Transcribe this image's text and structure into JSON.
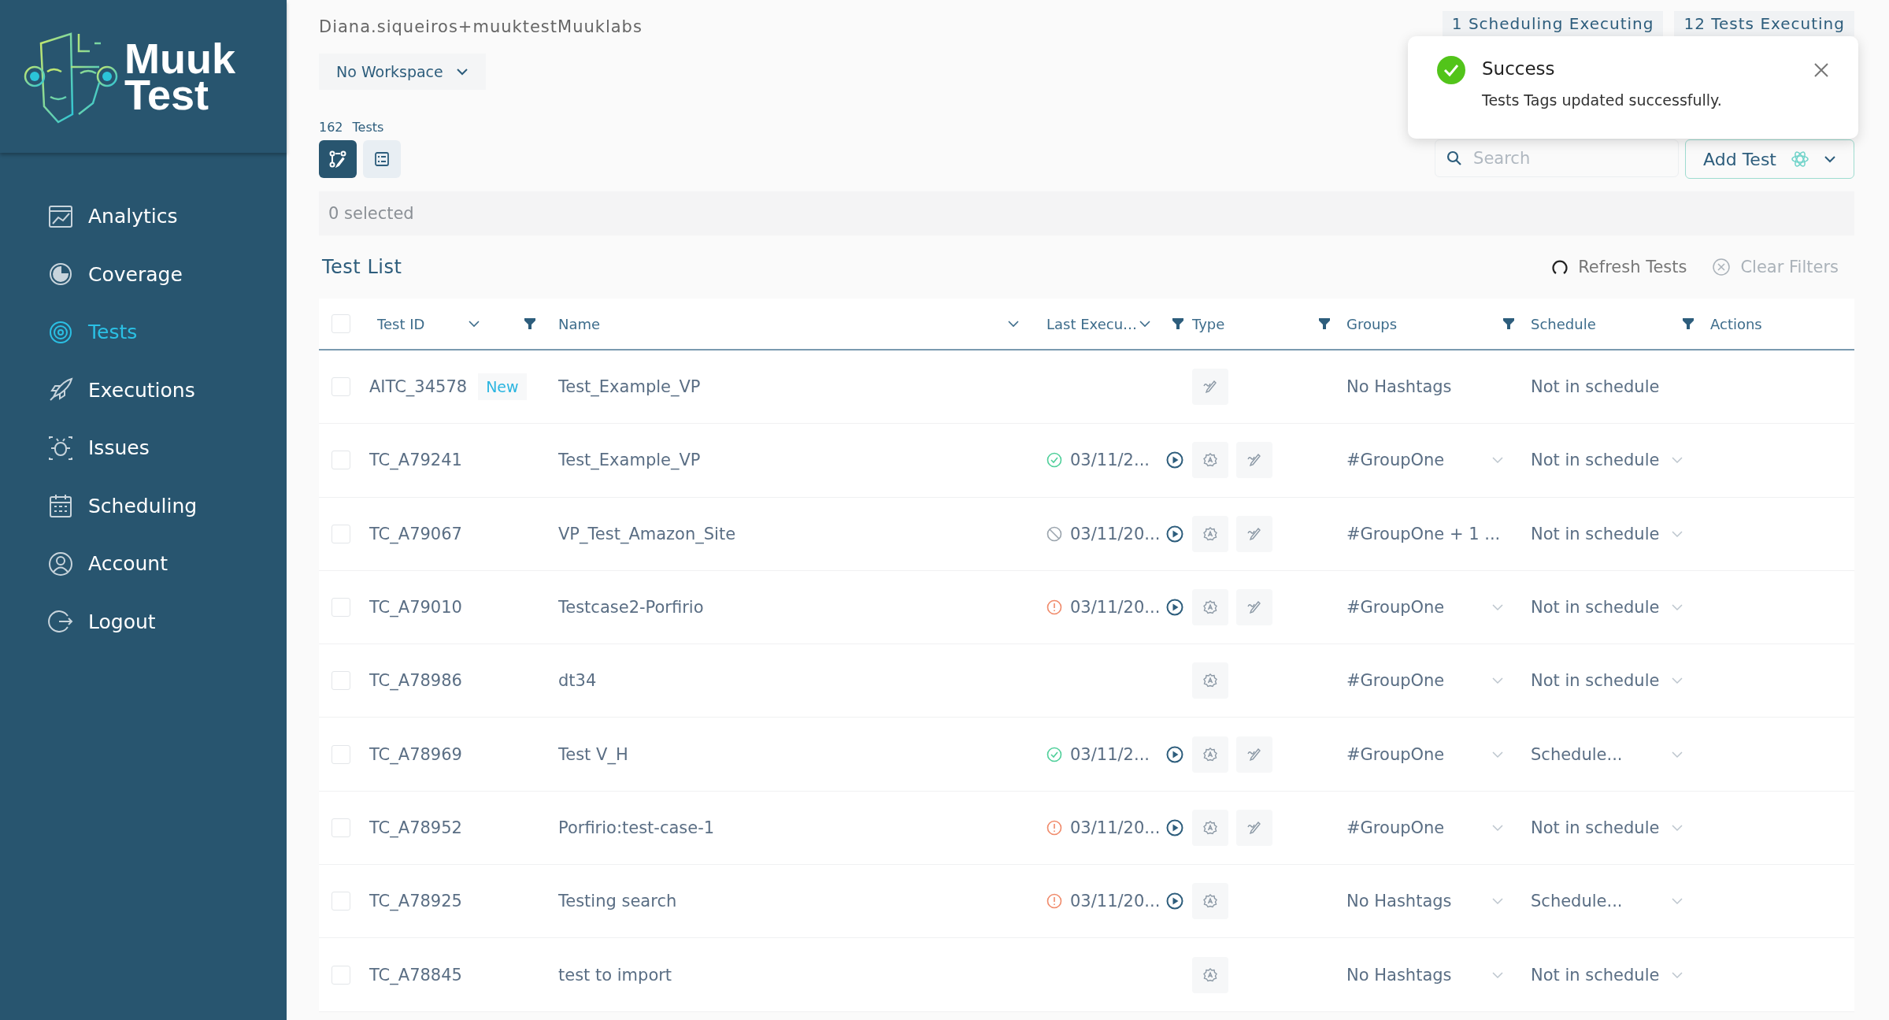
{
  "logo": {
    "line_1": "Muuk",
    "line_2": "Test"
  },
  "sidebar": {
    "items": [
      {
        "label": "Analytics",
        "selected": false
      },
      {
        "label": "Coverage",
        "selected": false
      },
      {
        "label": "Tests",
        "selected": true
      },
      {
        "label": "Executions",
        "selected": false
      },
      {
        "label": "Issues",
        "selected": false
      },
      {
        "label": "Scheduling",
        "selected": false
      },
      {
        "label": "Account",
        "selected": false
      },
      {
        "label": "Logout",
        "selected": false
      }
    ]
  },
  "header": {
    "user": "Diana.siqueiros+muuktestMuuklabs",
    "workspace": "No Workspace",
    "badges": [
      "1 Scheduling Executing",
      "12 Tests Executing"
    ]
  },
  "toast": {
    "title": "Success",
    "message": "Tests Tags updated successfully."
  },
  "count": {
    "number": "162",
    "label": "Tests"
  },
  "view_toggle": [
    {
      "kind": "flow",
      "selected": true
    },
    {
      "kind": "list",
      "selected": false
    }
  ],
  "search": {
    "placeholder": "Search"
  },
  "add_button": "Add Test",
  "selection": "0 selected",
  "list_title": "Test List",
  "refresh": "Refresh Tests",
  "clear_filters": {
    "label": "Clear Filters",
    "disabled": true
  },
  "table": {
    "select_all": {
      "checked": false
    },
    "columns": [
      {
        "label": "Test ID",
        "sortable": true,
        "filterable": true
      },
      {
        "label": "Name",
        "sortable": true,
        "filterable": false
      },
      {
        "label": "Last Execu…",
        "sortable": true,
        "filterable": true
      },
      {
        "label": "Type",
        "sortable": false,
        "filterable": true
      },
      {
        "label": "Groups",
        "sortable": false,
        "filterable": true
      },
      {
        "label": "Schedule",
        "sortable": false,
        "filterable": true
      },
      {
        "label": "Actions",
        "sortable": false,
        "filterable": false
      }
    ],
    "rows": [
      {
        "checked": false,
        "id": "AITC_34578",
        "badge": "New",
        "name": "Test_Example_VP",
        "types": [
          {
            "kind": "manual"
          }
        ],
        "groups": "No Hashtags",
        "schedule": "Not in schedule",
        "dropdowns": false
      },
      {
        "checked": false,
        "id": "TC_A79241",
        "name": "Test_Example_VP",
        "execution": {
          "kind": "passed",
          "date": "03/11/2..."
        },
        "types": [
          {
            "kind": "ai"
          },
          {
            "kind": "manual"
          }
        ],
        "groups": "#GroupOne",
        "schedule": "Not in schedule",
        "dropdowns": true
      },
      {
        "checked": false,
        "id": "TC_A79067",
        "name": "VP_Test_Amazon_Site",
        "execution": {
          "kind": "cancelled",
          "date": "03/11/20..."
        },
        "types": [
          {
            "kind": "ai"
          },
          {
            "kind": "manual"
          }
        ],
        "groups": "#GroupOne + 1 ...",
        "schedule": "Not in schedule",
        "dropdowns": true
      },
      {
        "checked": false,
        "id": "TC_A79010",
        "name": "Testcase2-Porfirio",
        "execution": {
          "kind": "failed",
          "date": "03/11/20..."
        },
        "types": [
          {
            "kind": "ai"
          },
          {
            "kind": "manual"
          }
        ],
        "groups": "#GroupOne",
        "schedule": "Not in schedule",
        "dropdowns": true
      },
      {
        "checked": false,
        "id": "TC_A78986",
        "name": "dt34",
        "types": [
          {
            "kind": "ai"
          }
        ],
        "groups": "#GroupOne",
        "schedule": "Not in schedule",
        "dropdowns": true
      },
      {
        "checked": false,
        "id": "TC_A78969",
        "name": "Test V_H",
        "execution": {
          "kind": "passed",
          "date": "03/11/2..."
        },
        "types": [
          {
            "kind": "ai"
          },
          {
            "kind": "manual"
          }
        ],
        "groups": "#GroupOne",
        "schedule": "Schedule...",
        "dropdowns": true
      },
      {
        "checked": false,
        "id": "TC_A78952",
        "name": "Porfirio:test-case-1",
        "execution": {
          "kind": "failed",
          "date": "03/11/20..."
        },
        "types": [
          {
            "kind": "ai"
          },
          {
            "kind": "manual"
          }
        ],
        "groups": "#GroupOne",
        "schedule": "Not in schedule",
        "dropdowns": true
      },
      {
        "checked": false,
        "id": "TC_A78925",
        "name": "Testing search",
        "execution": {
          "kind": "failed",
          "date": "03/11/20..."
        },
        "types": [
          {
            "kind": "ai"
          }
        ],
        "groups": "No Hashtags",
        "schedule": "Schedule...",
        "dropdowns": true
      },
      {
        "checked": false,
        "id": "TC_A78845",
        "name": "test to import",
        "types": [
          {
            "kind": "ai"
          }
        ],
        "groups": "No Hashtags",
        "schedule": "Not in schedule",
        "dropdowns": true
      }
    ]
  }
}
